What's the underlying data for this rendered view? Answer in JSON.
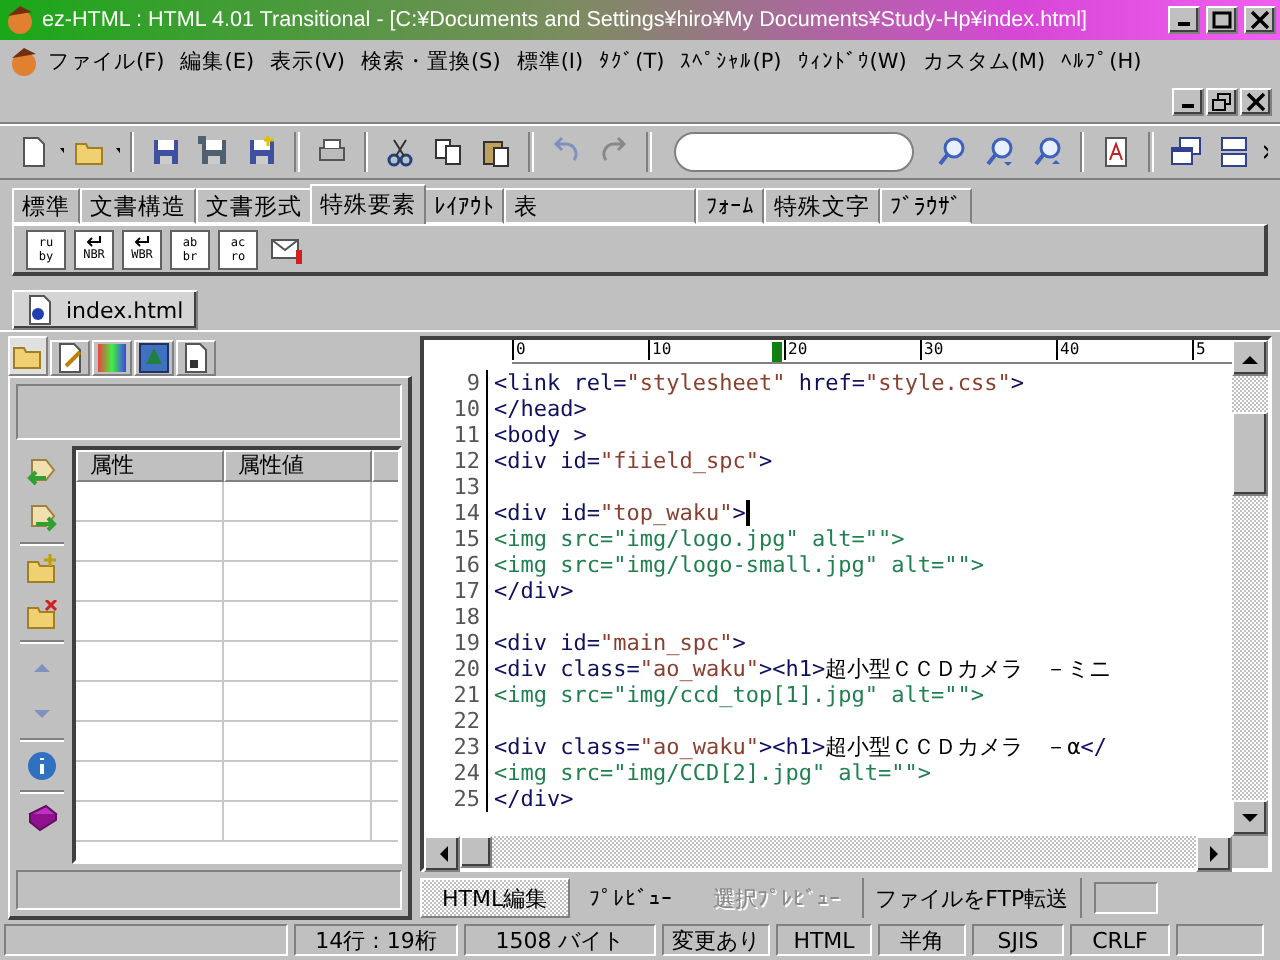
{
  "window": {
    "title": "ez-HTML : HTML 4.01 Transitional - [C:¥Documents and Settings¥hiro¥My Documents¥Study-Hp¥index.html]"
  },
  "menu": [
    "ファイル(F)",
    "編集(E)",
    "表示(V)",
    "検索・置換(S)",
    "標準(I)",
    "ﾀｸﾞ(T)",
    "ｽﾍﾟｼｬﾙ(P)",
    "ｳｨﾝﾄﾞｳ(W)",
    "カスタム(M)",
    "ﾍﾙﾌﾟ(H)"
  ],
  "element_tabs": [
    {
      "label": "標準",
      "selected": false
    },
    {
      "label": "文書構造",
      "selected": false
    },
    {
      "label": "文書形式",
      "selected": false
    },
    {
      "label": "特殊要素",
      "selected": true
    },
    {
      "label": "ﾚｲｱｳﾄ",
      "selected": false
    },
    {
      "label": "表",
      "selected": false
    },
    {
      "label": "ﾌｫｰﾑ",
      "selected": false
    },
    {
      "label": "特殊文字",
      "selected": false
    },
    {
      "label": "ﾌﾞﾗｳｻﾞ",
      "selected": false
    }
  ],
  "element_buttons": [
    {
      "kind": "stack",
      "lines": [
        "ru",
        "by"
      ]
    },
    {
      "kind": "break",
      "lines": [
        "NBR"
      ]
    },
    {
      "kind": "break",
      "lines": [
        "WBR"
      ]
    },
    {
      "kind": "stack",
      "lines": [
        "ab",
        "br"
      ]
    },
    {
      "kind": "stack",
      "lines": [
        "ac",
        "ro"
      ]
    },
    {
      "kind": "mail"
    }
  ],
  "document_tab": {
    "label": "index.html",
    "selected": true
  },
  "side_tabs": [
    {
      "selected": true
    },
    {
      "selected": false
    },
    {
      "selected": false
    },
    {
      "selected": false
    },
    {
      "selected": false
    }
  ],
  "attribute_table": {
    "columns": [
      "属性",
      "属性値"
    ]
  },
  "editor": {
    "ruler": [
      "0",
      "10",
      "20",
      "30",
      "40",
      "5"
    ],
    "lines": [
      {
        "number": "9",
        "caret": false,
        "segments": [
          {
            "kind": "tag",
            "text": "<link rel="
          },
          {
            "kind": "value",
            "text": "\"stylesheet\""
          },
          {
            "kind": "tag",
            "text": " href="
          },
          {
            "kind": "value",
            "text": "\"style.css\""
          },
          {
            "kind": "tag",
            "text": ">"
          }
        ]
      },
      {
        "number": "10",
        "caret": false,
        "segments": [
          {
            "kind": "tag",
            "text": "</head>"
          }
        ]
      },
      {
        "number": "11",
        "caret": false,
        "segments": [
          {
            "kind": "tag",
            "text": "<body >"
          }
        ]
      },
      {
        "number": "12",
        "caret": false,
        "segments": [
          {
            "kind": "tag",
            "text": "<div id="
          },
          {
            "kind": "value",
            "text": "\"fiield_spc\""
          },
          {
            "kind": "tag",
            "text": ">"
          }
        ]
      },
      {
        "number": "13",
        "caret": false
      },
      {
        "number": "14",
        "caret": true,
        "segments": [
          {
            "kind": "tag",
            "text": "<div id="
          },
          {
            "kind": "value",
            "text": "\"top_waku\""
          },
          {
            "kind": "tag",
            "text": ">"
          }
        ]
      },
      {
        "number": "15",
        "caret": false,
        "segments": [
          {
            "kind": "img",
            "text": "<img src=\"img/logo.jpg\" alt=\"\">"
          }
        ]
      },
      {
        "number": "16",
        "caret": false,
        "segments": [
          {
            "kind": "img",
            "text": "<img src=\"img/logo-small.jpg\" alt=\"\">"
          }
        ]
      },
      {
        "number": "17",
        "caret": false,
        "segments": [
          {
            "kind": "tag",
            "text": "</div>"
          }
        ]
      },
      {
        "number": "18",
        "caret": false
      },
      {
        "number": "19",
        "caret": false,
        "segments": [
          {
            "kind": "tag",
            "text": "<div id="
          },
          {
            "kind": "value",
            "text": "\"main_spc\""
          },
          {
            "kind": "tag",
            "text": ">"
          }
        ]
      },
      {
        "number": "20",
        "caret": false,
        "segments": [
          {
            "kind": "tag",
            "text": "<div class="
          },
          {
            "kind": "value",
            "text": "\"ao_waku\""
          },
          {
            "kind": "tag",
            "text": "><h1>"
          },
          {
            "kind": "plain",
            "text": "超小型ＣＣＤカメラ　－ミニ"
          }
        ]
      },
      {
        "number": "21",
        "caret": false,
        "segments": [
          {
            "kind": "img",
            "text": "<img src=\"img/ccd_top[1].jpg\" alt=\"\">"
          }
        ]
      },
      {
        "number": "22",
        "caret": false
      },
      {
        "number": "23",
        "caret": false,
        "segments": [
          {
            "kind": "tag",
            "text": "<div class="
          },
          {
            "kind": "value",
            "text": "\"ao_waku\""
          },
          {
            "kind": "tag",
            "text": "><h1>"
          },
          {
            "kind": "plain",
            "text": "超小型ＣＣＤカメラ　－α"
          },
          {
            "kind": "tag",
            "text": "</"
          }
        ]
      },
      {
        "number": "24",
        "caret": false,
        "segments": [
          {
            "kind": "img",
            "text": "<img src=\"img/CCD[2].jpg\" alt=\"\">"
          }
        ]
      },
      {
        "number": "25",
        "caret": false,
        "segments": [
          {
            "kind": "tag",
            "text": "</div>"
          }
        ]
      }
    ]
  },
  "view_tabs": [
    {
      "label": "HTML編集",
      "selected": true,
      "disabled": false
    },
    {
      "label": "ﾌﾟﾚﾋﾞｭｰ",
      "selected": false,
      "disabled": false
    },
    {
      "label": "選択ﾌﾟﾚﾋﾞｭｰ",
      "selected": false,
      "disabled": true
    }
  ],
  "ftp_button": {
    "label": "ファイルをFTP転送"
  },
  "status_bar": [
    "14行 : 19桁",
    "1508 バイト",
    "変更あり",
    "HTML",
    "半角",
    "SJIS",
    "CRLF"
  ]
}
